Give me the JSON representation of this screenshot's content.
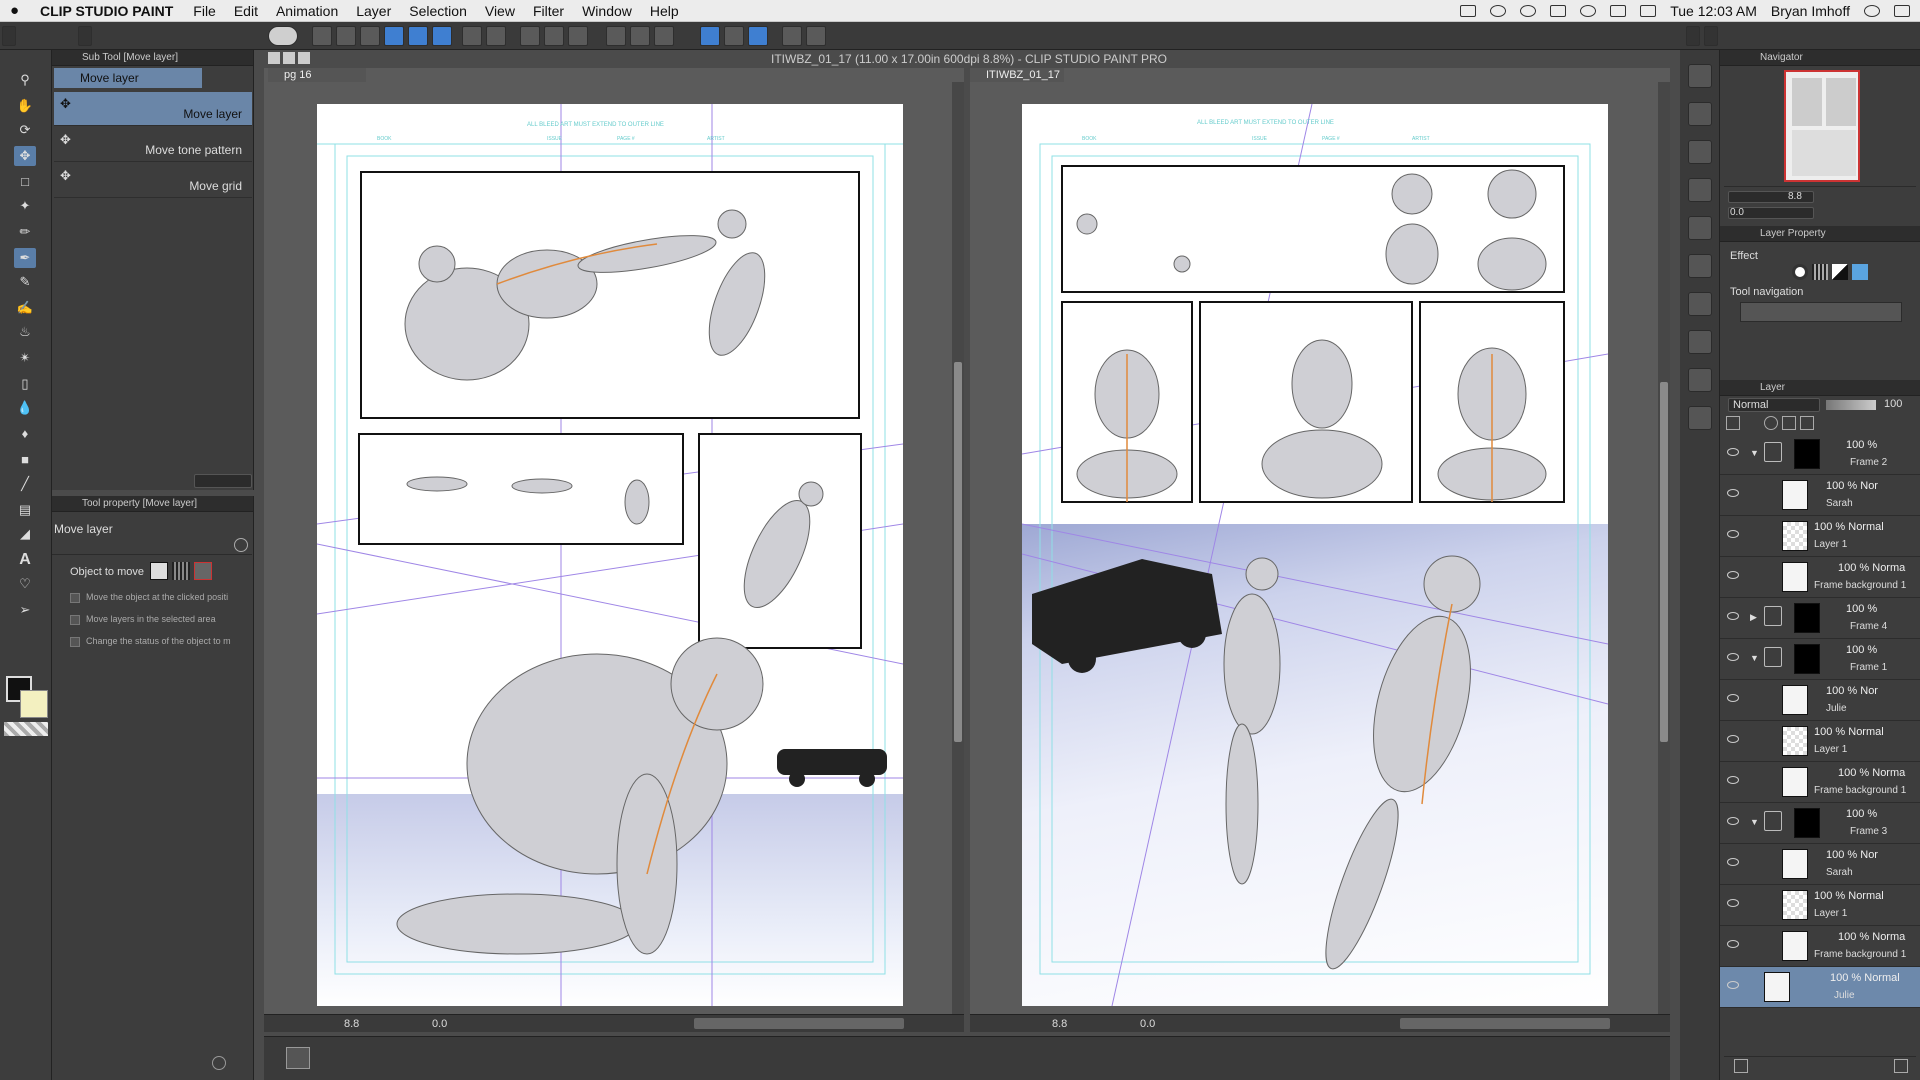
{
  "menubar": {
    "app_name": "CLIP STUDIO PAINT",
    "items": [
      "File",
      "Edit",
      "Animation",
      "Layer",
      "Selection",
      "View",
      "Filter",
      "Window",
      "Help"
    ],
    "clock": "Tue 12:03 AM",
    "user": "Bryan Imhoff"
  },
  "window_title": "ITIWBZ_01_17 (11.00 x 17.00in 600dpi 8.8%) - CLIP STUDIO PAINT PRO",
  "subtool_panel": {
    "header": "Sub Tool [Move layer]",
    "group_tab": "Move layer",
    "items": [
      "Move layer",
      "Move tone pattern",
      "Move grid"
    ]
  },
  "tool_property": {
    "header": "Tool property [Move layer]",
    "title": "Move layer",
    "object_label": "Object to move",
    "options": [
      "Move the object at the clicked positi",
      "Move layers in the selected area",
      "Change the status of the object to m"
    ]
  },
  "documents": [
    {
      "tab": "pg 16",
      "zoom": "8.8",
      "angle": "0.0"
    },
    {
      "tab": "ITIWBZ_01_17",
      "zoom": "8.8",
      "angle": "0.0"
    }
  ],
  "page_text": {
    "top_note": "ALL BLEED ART MUST EXTEND TO OUTER LINE",
    "marks": [
      "BOOK",
      "ISSUE",
      "PAGE #",
      "ARTIST"
    ]
  },
  "navigator": {
    "title": "Navigator",
    "zoom": "8.8",
    "angle": "0.0"
  },
  "layer_property": {
    "title": "Layer Property",
    "effect_label": "Effect",
    "tool_nav_label": "Tool navigation"
  },
  "layer_panel": {
    "title": "Layer",
    "blend_mode": "Normal",
    "opacity": "100",
    "layers": [
      {
        "pct": "100 %",
        "name": "Frame 2",
        "type": "folder"
      },
      {
        "pct": "100 % Nor",
        "name": "Sarah",
        "type": "model"
      },
      {
        "pct": "100 % Normal",
        "name": "Layer 1",
        "type": "raster"
      },
      {
        "pct": "100 % Norma",
        "name": "Frame background 1",
        "type": "bg"
      },
      {
        "pct": "100 %",
        "name": "Frame 4",
        "type": "folder"
      },
      {
        "pct": "100 %",
        "name": "Frame 1",
        "type": "folder"
      },
      {
        "pct": "100 % Nor",
        "name": "Julie",
        "type": "model"
      },
      {
        "pct": "100 % Normal",
        "name": "Layer 1",
        "type": "raster"
      },
      {
        "pct": "100 % Norma",
        "name": "Frame background 1",
        "type": "bg"
      },
      {
        "pct": "100 %",
        "name": "Frame 3",
        "type": "folder"
      },
      {
        "pct": "100 % Nor",
        "name": "Sarah",
        "type": "model"
      },
      {
        "pct": "100 % Normal",
        "name": "Layer 1",
        "type": "raster"
      },
      {
        "pct": "100 % Norma",
        "name": "Frame background 1",
        "type": "bg"
      },
      {
        "pct": "100 % Normal",
        "name": "Julie",
        "type": "model"
      }
    ]
  }
}
